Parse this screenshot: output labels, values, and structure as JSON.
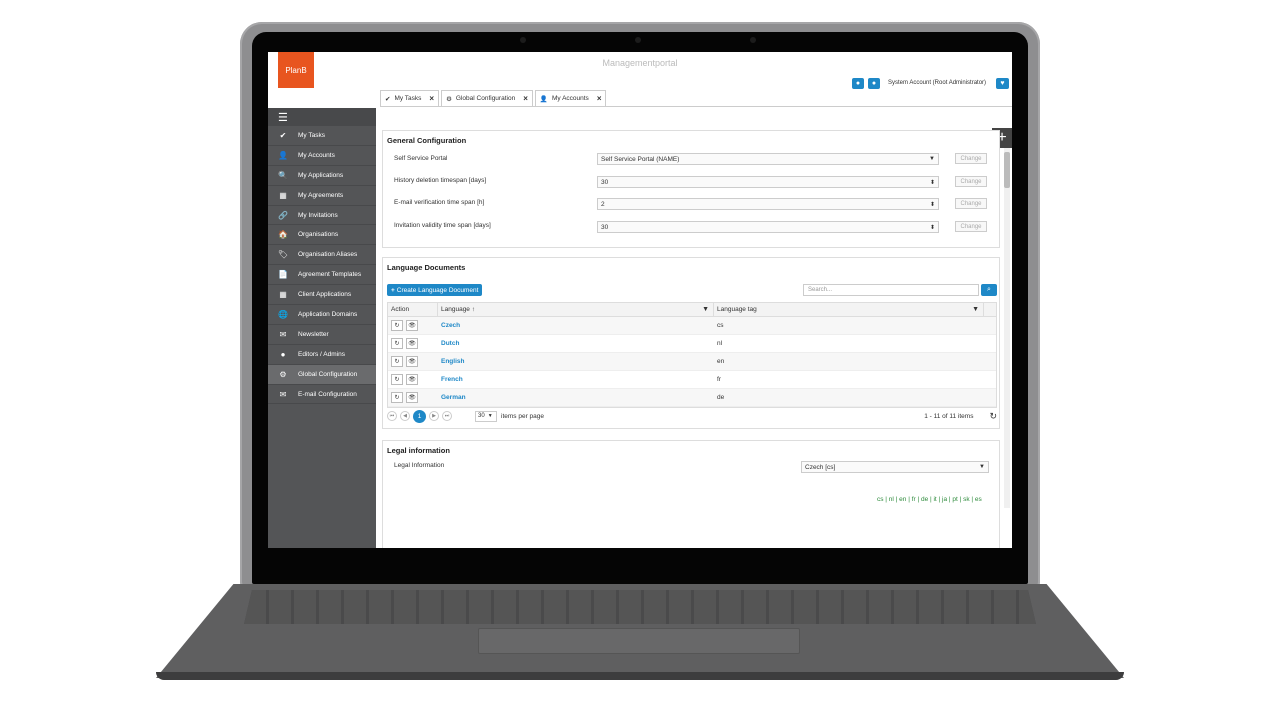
{
  "app": {
    "logo": "PlanB",
    "title": "Managementportal",
    "account": "System Account (Root Administrator)"
  },
  "tabs": [
    {
      "label": "My Tasks"
    },
    {
      "label": "Global Configuration"
    },
    {
      "label": "My Accounts"
    }
  ],
  "sidebar": [
    {
      "label": "My Tasks",
      "icon": "✔"
    },
    {
      "label": "My Accounts",
      "icon": "👤"
    },
    {
      "label": "My Applications",
      "icon": "🔍"
    },
    {
      "label": "My Agreements",
      "icon": "▦"
    },
    {
      "label": "My Invitations",
      "icon": "🔗"
    },
    {
      "label": "Organisations",
      "icon": "🏠"
    },
    {
      "label": "Organisation Aliases",
      "icon": "🏷"
    },
    {
      "label": "Agreement Templates",
      "icon": "📄"
    },
    {
      "label": "Client Applications",
      "icon": "▦"
    },
    {
      "label": "Application Domains",
      "icon": "🌐"
    },
    {
      "label": "Newsletter",
      "icon": "✉"
    },
    {
      "label": "Editors / Admins",
      "icon": "●"
    },
    {
      "label": "Global Configuration",
      "icon": "⚙"
    },
    {
      "label": "E-mail Configuration",
      "icon": "✉"
    }
  ],
  "general": {
    "title": "General Configuration",
    "rows": [
      {
        "label": "Self Service Portal",
        "value": "Self Service Portal (NAME)",
        "arrow": "▼"
      },
      {
        "label": "History deletion timespan [days]",
        "value": "30",
        "arrow": "⬍"
      },
      {
        "label": "E-mail verification time span [h]",
        "value": "2",
        "arrow": "⬍"
      },
      {
        "label": "Invitation validity time span [days]",
        "value": "30",
        "arrow": "⬍"
      }
    ],
    "change_label": "Change"
  },
  "langdocs": {
    "title": "Language Documents",
    "create_label": "Create Language Document",
    "search_placeholder": "Search...",
    "columns": {
      "action": "Action",
      "language": "Language ↑",
      "tag": "Language tag"
    },
    "rows": [
      {
        "language": "Czech",
        "tag": "cs"
      },
      {
        "language": "Dutch",
        "tag": "nl"
      },
      {
        "language": "English",
        "tag": "en"
      },
      {
        "language": "French",
        "tag": "fr"
      },
      {
        "language": "German",
        "tag": "de"
      }
    ],
    "pager": {
      "current": "1",
      "per_page": "30",
      "per_page_label": "items per page",
      "summary": "1 - 11 of 11 items"
    }
  },
  "legal": {
    "title": "Legal information",
    "label": "Legal Information",
    "value": "Czech [cs]",
    "links": "cs | nl | en | fr | de | it | ja | pt | sk | es"
  },
  "colors": {
    "accent": "#1e88c7",
    "brand": "#e8551f",
    "sidebar": "#545557"
  }
}
